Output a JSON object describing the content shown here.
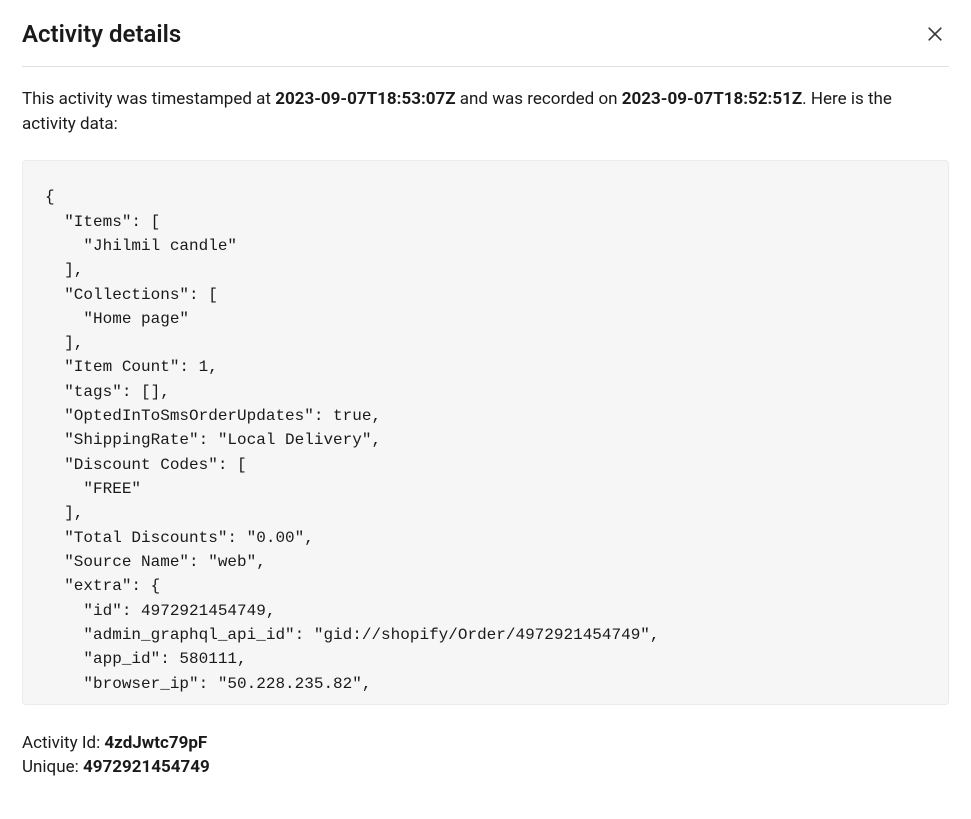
{
  "header": {
    "title": "Activity details"
  },
  "intro": {
    "prefix": "This activity was timestamped at ",
    "timestamped_at": "2023-09-07T18:53:07Z",
    "middle": " and was recorded on ",
    "recorded_on": "2023-09-07T18:52:51Z",
    "suffix": ". Here is the activity data:"
  },
  "code": "{\n  \"Items\": [\n    \"Jhilmil candle\"\n  ],\n  \"Collections\": [\n    \"Home page\"\n  ],\n  \"Item Count\": 1,\n  \"tags\": [],\n  \"OptedInToSmsOrderUpdates\": true,\n  \"ShippingRate\": \"Local Delivery\",\n  \"Discount Codes\": [\n    \"FREE\"\n  ],\n  \"Total Discounts\": \"0.00\",\n  \"Source Name\": \"web\",\n  \"extra\": {\n    \"id\": 4972921454749,\n    \"admin_graphql_api_id\": \"gid://shopify/Order/4972921454749\",\n    \"app_id\": 580111,\n    \"browser_ip\": \"50.228.235.82\",",
  "footer": {
    "activity_id_label": "Activity Id: ",
    "activity_id_value": "4zdJwtc79pF",
    "unique_label": "Unique: ",
    "unique_value": "4972921454749"
  }
}
